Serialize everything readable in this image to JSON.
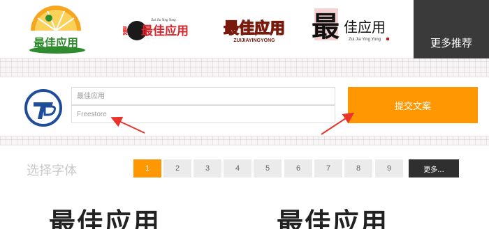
{
  "logos": [
    {
      "text": "最佳应用",
      "sublabel": ""
    },
    {
      "text": "最佳应用",
      "sublabel": "Zui Jia Ying Yong"
    },
    {
      "text": "最佳应用",
      "sublabel": "ZUIJIAYINGYONG"
    },
    {
      "text": "佳应用",
      "sublabel": "Zui Jia Ying Yong"
    }
  ],
  "header": {
    "more_label": "更多推荐"
  },
  "form": {
    "field1_placeholder": "最佳应用",
    "field2_placeholder": "Freestore",
    "submit_label": "提交文案"
  },
  "font_select": {
    "label": "选择字体",
    "pages": [
      "1",
      "2",
      "3",
      "4",
      "5",
      "6",
      "7",
      "8",
      "9"
    ],
    "active_page": "1",
    "more_label": "更多...",
    "previews": [
      "最佳应用",
      "最佳应用"
    ]
  },
  "colors": {
    "accent": "#fe9702",
    "dark": "#3a3a3a",
    "arrow": "#e8342a"
  }
}
